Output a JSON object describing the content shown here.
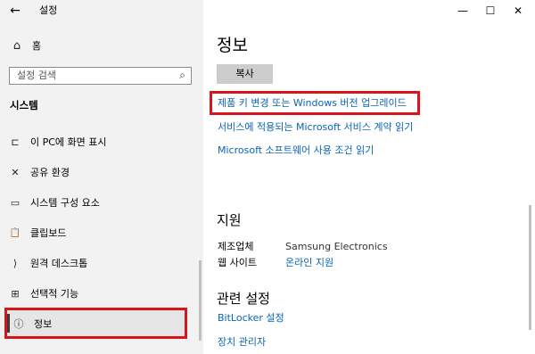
{
  "window": {
    "title": "설정",
    "back_glyph": "←",
    "minimize_glyph": "—",
    "maximize_glyph": "☐",
    "close_glyph": "✕"
  },
  "sidebar": {
    "home": {
      "label": "홈",
      "icon": "home-icon",
      "glyph": "⌂"
    },
    "search": {
      "placeholder": "설정 검색",
      "icon": "search-icon",
      "glyph": "⌕"
    },
    "section_label": "시스템",
    "items": [
      {
        "label": "이 PC에 화면 표시",
        "icon": "project-to-pc-icon",
        "glyph": "⊏"
      },
      {
        "label": "공유 환경",
        "icon": "shared-experiences-icon",
        "glyph": "✕"
      },
      {
        "label": "시스템 구성 요소",
        "icon": "system-components-icon",
        "glyph": "▭"
      },
      {
        "label": "클립보드",
        "icon": "clipboard-icon",
        "glyph": "📋"
      },
      {
        "label": "원격 데스크톱",
        "icon": "remote-desktop-icon",
        "glyph": "⟩"
      },
      {
        "label": "선택적 기능",
        "icon": "optional-features-icon",
        "glyph": "⊞"
      },
      {
        "label": "정보",
        "icon": "about-info-icon",
        "glyph": "ⓘ",
        "selected": true
      }
    ]
  },
  "main": {
    "title": "정보",
    "copy_button": "복사",
    "links": [
      "제품 키 변경 또는 Windows 버전 업그레이드",
      "서비스에 적용되는 Microsoft 서비스 계약 읽기",
      "Microsoft 소프트웨어 사용 조건 읽기"
    ],
    "support": {
      "heading": "지원",
      "manufacturer_label": "제조업체",
      "manufacturer_value": "Samsung Electronics",
      "website_label": "웹 사이트",
      "website_value": "온라인 지원"
    },
    "related": {
      "heading": "관련 설정",
      "links": [
        "BitLocker 설정",
        "장치 관리자"
      ]
    }
  },
  "colors": {
    "link": "#0b63b6",
    "highlight": "#d9141b",
    "sidebar_bg": "#f2f2f2"
  }
}
